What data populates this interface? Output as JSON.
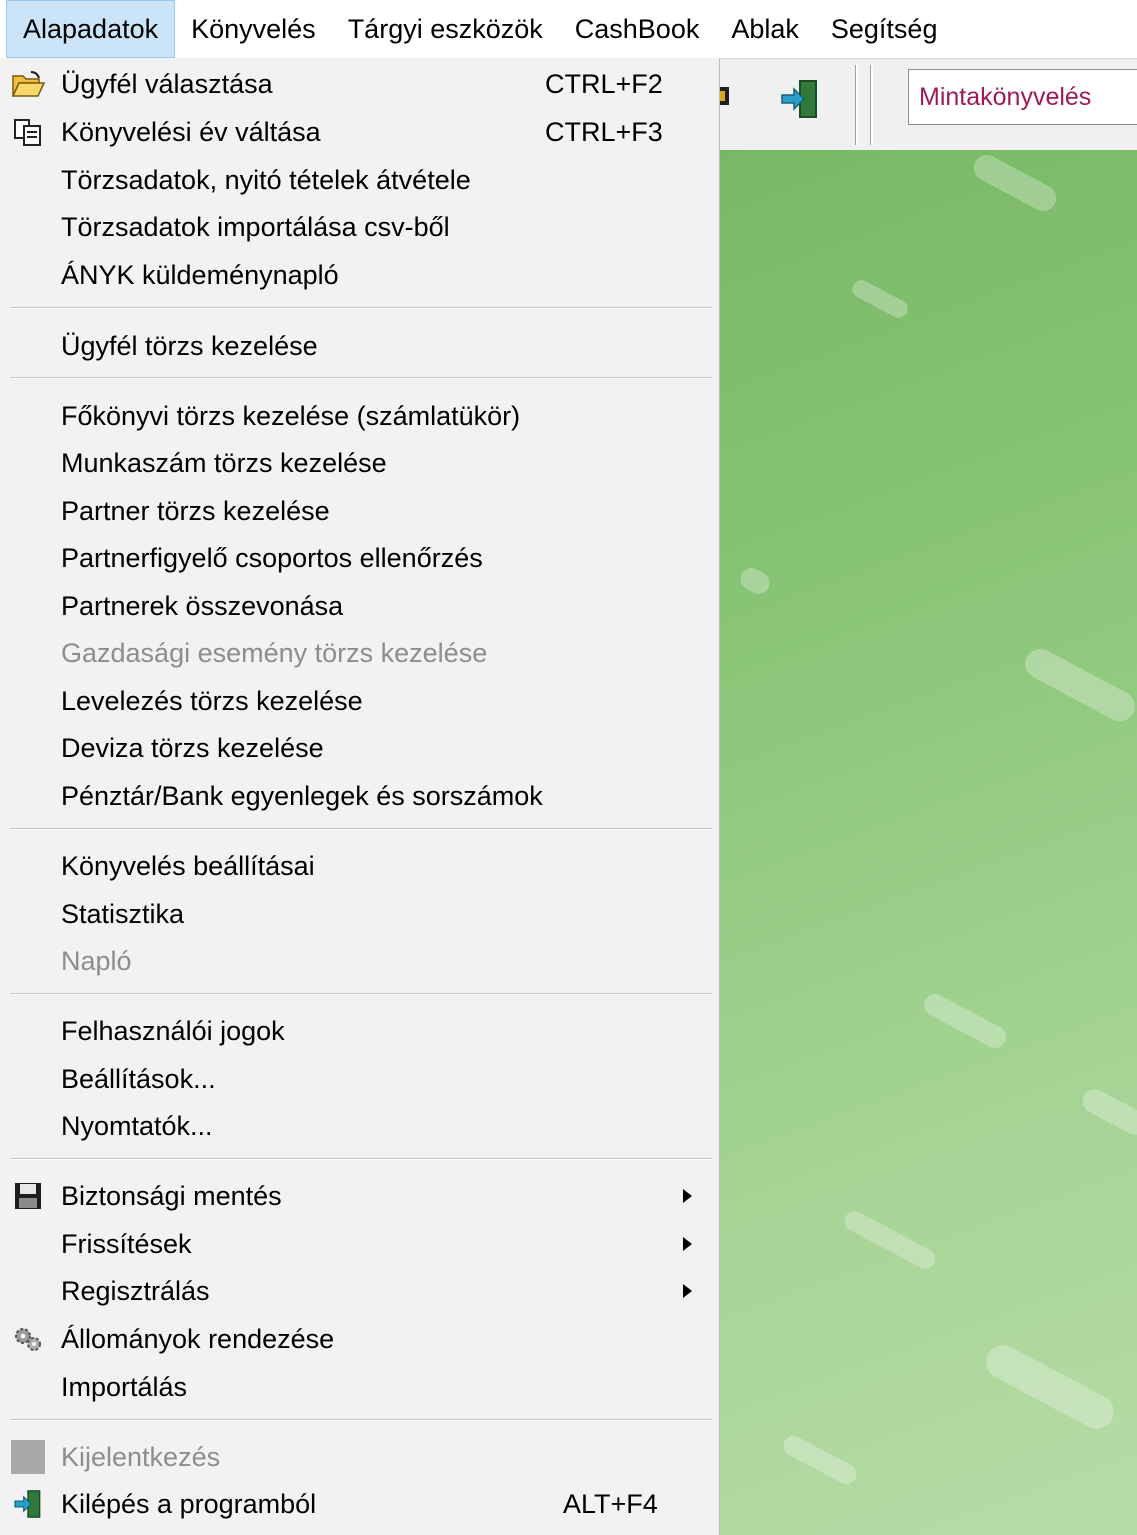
{
  "menubar": {
    "items": [
      "Alapadatok",
      "Könyvelés",
      "Tárgyi eszközök",
      "CashBook",
      "Ablak",
      "Segítség"
    ]
  },
  "toolbar": {
    "client_name": "Mintakönyvelés"
  },
  "menu": {
    "items": [
      {
        "label": "Ügyfél választása",
        "shortcut": "CTRL+F2",
        "icon": "open-folder-icon"
      },
      {
        "label": "Könyvelési év váltása",
        "shortcut": "CTRL+F3",
        "icon": "copy-pages-icon"
      },
      {
        "label": "Törzsadatok, nyitó tételek átvétele"
      },
      {
        "label": "Törzsadatok importálása csv-ből"
      },
      {
        "label": "ÁNYK küldeménynapló"
      },
      {
        "label": "Ügyfél törzs kezelése"
      },
      {
        "label": "Főkönyvi törzs kezelése (számlatükör)"
      },
      {
        "label": "Munkaszám törzs kezelése"
      },
      {
        "label": "Partner törzs kezelése"
      },
      {
        "label": "Partnerfigyelő csoportos ellenőrzés"
      },
      {
        "label": "Partnerek összevonása"
      },
      {
        "label": "Gazdasági esemény törzs kezelése",
        "disabled": true
      },
      {
        "label": "Levelezés törzs kezelése"
      },
      {
        "label": "Deviza törzs kezelése"
      },
      {
        "label": "Pénztár/Bank egyenlegek és sorszámok"
      },
      {
        "label": "Könyvelés beállításai"
      },
      {
        "label": "Statisztika"
      },
      {
        "label": "Napló",
        "disabled": true
      },
      {
        "label": "Felhasználói jogok"
      },
      {
        "label": "Beállítások..."
      },
      {
        "label": "Nyomtatók..."
      },
      {
        "label": "Biztonsági mentés",
        "submenu": true,
        "icon": "floppy-disk-icon"
      },
      {
        "label": "Frissítések",
        "submenu": true
      },
      {
        "label": "Regisztrálás",
        "submenu": true
      },
      {
        "label": "Állományok rendezése",
        "icon": "gears-icon"
      },
      {
        "label": "Importálás"
      },
      {
        "label": "Kijelentkezés",
        "disabled": true,
        "icon": "logout-icon"
      },
      {
        "label": "Kilépés a programból",
        "shortcut": "ALT+F4",
        "icon": "exit-door-icon"
      }
    ]
  },
  "colors": {
    "menu_bg": "#f2f2f2",
    "active_menu_bg": "#cce4f7",
    "client_name_color": "#9b1b5a",
    "workspace_green": "#8bc679",
    "disabled_text": "#8d8d8d"
  }
}
